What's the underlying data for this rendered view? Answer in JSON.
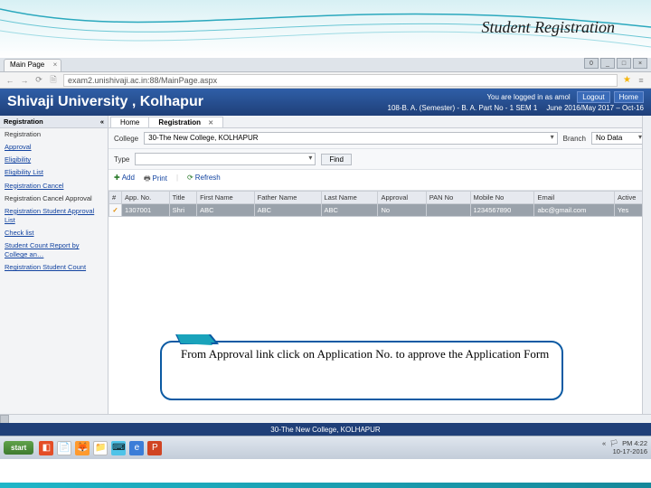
{
  "slide": {
    "title": "Student Registration"
  },
  "browser": {
    "tab_label": "Main Page",
    "url": "exam2.unishivaji.ac.in:88/MainPage.aspx"
  },
  "uni": {
    "name": "Shivaji University , Kolhapur",
    "logged_in_as": "You are logged in as amol",
    "period": "June 2016/May 2017 – Oct-16",
    "subperiod": "108-B. A. (Semester) - B. A. Part No - 1 SEM 1",
    "logout": "Logout",
    "home": "Home"
  },
  "sidebar": {
    "heading": "Registration",
    "collapse": "«",
    "items": [
      "Registration",
      "Approval",
      "Eligibility",
      "Eligibility List",
      "Registration Cancel",
      "Registration Cancel Approval",
      "Registration Student Approval List",
      "Check list",
      "Student Count Report by College an…",
      "Registration Student Count"
    ]
  },
  "main": {
    "tabs": [
      {
        "label": "Home",
        "closable": false
      },
      {
        "label": "Registration",
        "closable": true
      }
    ],
    "filters": {
      "college_label": "College",
      "college_value": "30-The New College, KOLHAPUR",
      "branch_label": "Branch",
      "branch_value": "No Data",
      "type_label": "Type",
      "type_value": "",
      "find": "Find"
    },
    "toolbar": {
      "add": "Add",
      "print": "Print",
      "refresh": "Refresh"
    },
    "columns": [
      "#",
      "App. No.",
      "Title",
      "First Name",
      "Father Name",
      "Last Name",
      "Approval",
      "PAN No",
      "Mobile No",
      "Email",
      "Active"
    ],
    "row": {
      "idx": "✓",
      "app_no": "1307001",
      "title": "Shri",
      "first": "ABC",
      "father": "ABC",
      "last": "ABC",
      "approval": "No",
      "pan": "",
      "mobile": "1234567890",
      "email": "abc@gmail.com",
      "active": "Yes"
    }
  },
  "callout": {
    "text": "From Approval link click on Application No. to approve the Application Form"
  },
  "footer": {
    "college": "30-The New College, KOLHAPUR"
  },
  "taskbar": {
    "start": "start",
    "time": "PM 4:22",
    "date": "10-17-2016"
  }
}
